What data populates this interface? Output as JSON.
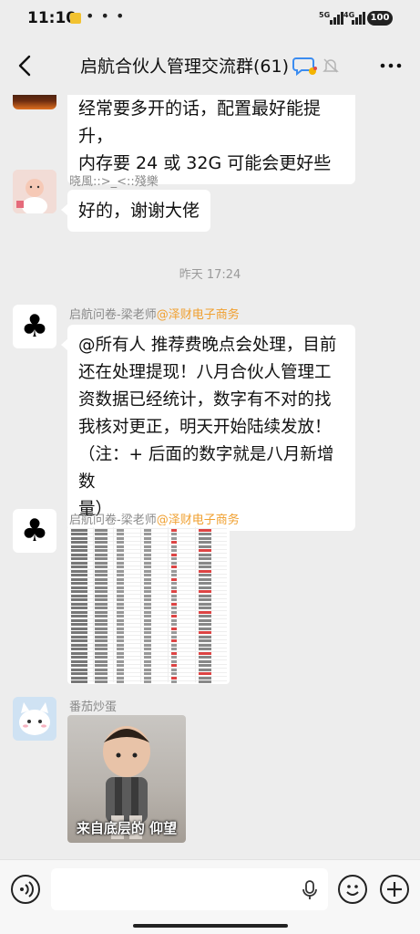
{
  "status_bar": {
    "time": "11:10",
    "notif_label": "美团",
    "signal_1": "5G",
    "signal_2": "4G",
    "battery": "100"
  },
  "header": {
    "title": "启航合伙人管理交流群(61)"
  },
  "messages": [
    {
      "sender": "",
      "text_line1": "经常要多开的话，配置最好能提升，",
      "text_line2": "内存要 24 或 32G 可能会更好些"
    },
    {
      "sender": "晓風::>_<::殘樂",
      "text": "好的，谢谢大佬"
    },
    {
      "timestamp": "昨天 17:24"
    },
    {
      "sender": "启航问卷-梁老师",
      "sender_tag": "@泽财电子商务",
      "lines": [
        "@所有人 推荐费晚点会处理，目前",
        "还在处理提现！八月合伙人管理工",
        "资数据已经统计，数字有不对的找",
        "我核对更正，明天开始陆续发放！",
        "（注：+ 后面的数字就是八月新增数",
        "量）"
      ]
    },
    {
      "sender": "启航问卷-梁老师",
      "sender_tag": "@泽财电子商务",
      "type": "image"
    },
    {
      "sender": "番茄炒蛋",
      "type": "sticker",
      "caption": "来自底层的 仰望"
    }
  ],
  "icons": {
    "back": "chevron-left-icon",
    "group": "group-chat-icon",
    "mute": "bell-off-icon",
    "more": "more-dots-icon",
    "voice": "voice-icon",
    "mic": "mic-icon",
    "emoji": "emoji-icon",
    "plus": "plus-icon",
    "club": "club-suit-icon"
  },
  "colors": {
    "background": "#ededed",
    "bubble": "#ffffff",
    "mention": "#f0a030",
    "meta_text": "#8a8a8a"
  }
}
